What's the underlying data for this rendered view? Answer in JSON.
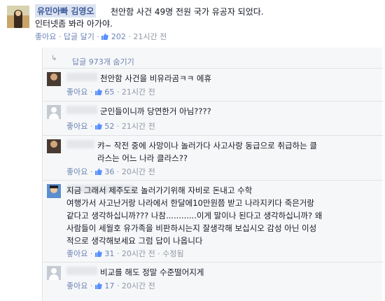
{
  "post": {
    "author": "유민아빠 김영오",
    "text_line1": "천안함 사건 49명 전원 국가 유공자 되었다.",
    "text_line2": "인터넷좀 봐라 아가야.",
    "like_label": "좋아요",
    "reply_label": "답글 달기",
    "like_count": "202",
    "time": "21시간 전",
    "separator": "·"
  },
  "comments_section": {
    "hide_label": "답글 973개 숨기기",
    "items": [
      {
        "text": "천안함 사건을 비유라곰ㅋㅋ 에휴",
        "like_label": "좋아요",
        "likes": "65",
        "time": "21시간 전",
        "edited": ""
      },
      {
        "text": "군인들이니까 당연한거 아님????",
        "like_label": "좋아요",
        "likes": "52",
        "time": "21시간 전",
        "edited": ""
      },
      {
        "text": "캬~ 작전 중에 사망이나 놀러가다 사고사랑 동급으로 취급하는 클\n라스는 어느 나라 클라스??",
        "like_label": "좋아요",
        "likes": "36",
        "time": "20시간 전",
        "edited": ""
      },
      {
        "text": "지금 그래서 제주도로 놀러가기위해 자비로 돈내고 수학\n여행가서 사고난거랑 나라에서 한달에10만원쯤 받고 나라지키다 죽은거랑\n같다고 생각하십니까??? 나참............이게 말이나 된다고 생각하십니까? 왜\n사람들이 세월호 유가족을 비판하시는지 잘생각해 보십시오 감성 아닌 이성\n적으로 생각해보세요 그럼 답이 나옵니다",
        "like_label": "좋아요",
        "likes": "31",
        "time": "20시간 전",
        "edited": "수정됨"
      },
      {
        "text": "비교를 해도 정말 수준떨어지게",
        "like_label": "좋아요",
        "likes": "17",
        "time": "20시간 전",
        "edited": ""
      }
    ]
  }
}
